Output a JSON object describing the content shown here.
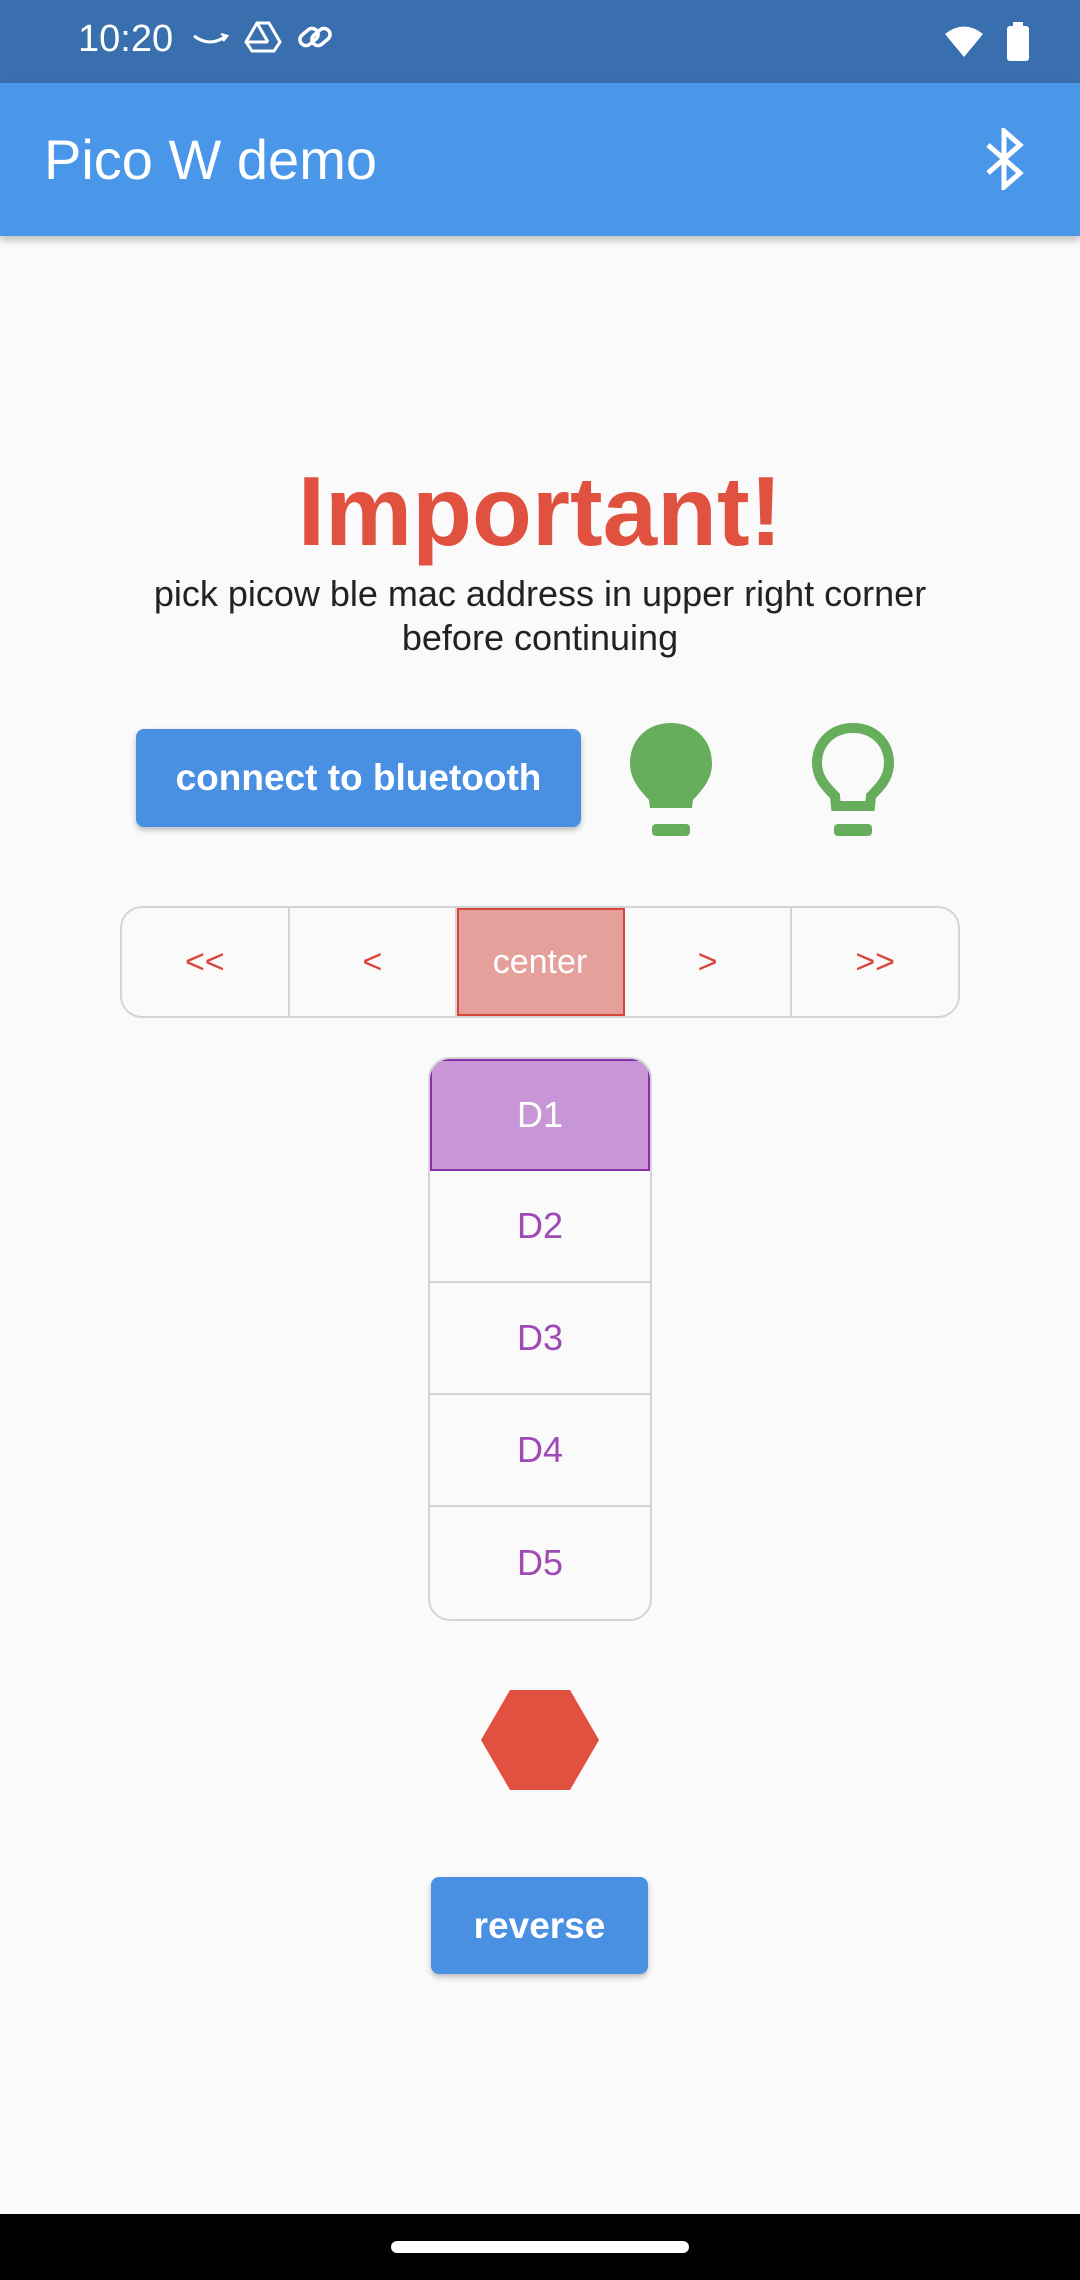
{
  "status_bar": {
    "time": "10:20",
    "left_icons": [
      "amazon-smile-icon",
      "drive-icon",
      "link-icon"
    ],
    "right_icons": [
      "wifi-icon",
      "battery-icon"
    ]
  },
  "app_bar": {
    "title": "Pico W demo",
    "action_icon": "bluetooth-icon"
  },
  "main": {
    "heading": "Important!",
    "subtitle": "pick picow ble mac address in upper right corner before continuing",
    "connect_label": "connect to bluetooth",
    "bulbs": [
      {
        "icon": "lightbulb-filled-icon",
        "state": "on"
      },
      {
        "icon": "lightbulb-outline-icon",
        "state": "off"
      }
    ],
    "direction_segments": [
      "<<",
      "<",
      "center",
      ">",
      ">>"
    ],
    "direction_selected": "center",
    "speed_segments": [
      "D1",
      "D2",
      "D3",
      "D4",
      "D5"
    ],
    "speed_selected": "D1",
    "stop_icon": "hexagon-icon",
    "reverse_label": "reverse"
  },
  "colors": {
    "app_bar": "#4a97ea",
    "status_bar": "#3a6faf",
    "accent_red": "#e0523f",
    "bulb_green": "#66ad5c",
    "segment_purple": "#a04ab5"
  }
}
